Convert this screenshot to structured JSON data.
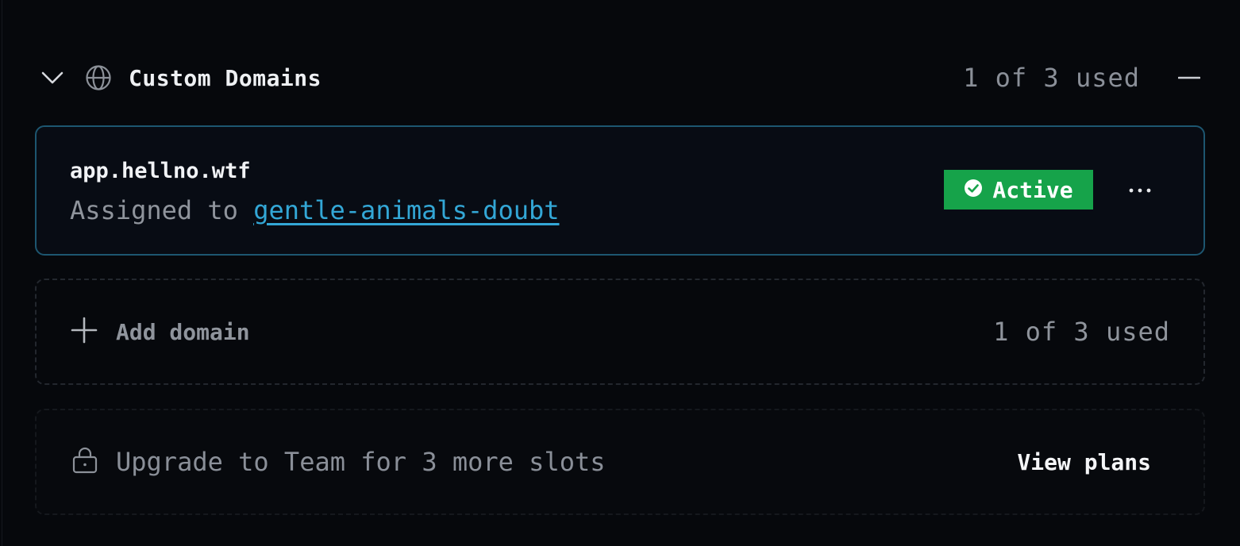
{
  "section": {
    "title": "Custom Domains",
    "usage": "1 of 3 used",
    "icons": {
      "toggle": "chevron-down-icon",
      "section": "globe-icon",
      "collapse": "minus-icon"
    }
  },
  "domains": [
    {
      "name": "app.hellno.wtf",
      "assigned_prefix": "Assigned to",
      "assigned_target": "gentle-animals-doubt",
      "status": "Active",
      "status_icon": "check-circle-icon",
      "menu_icon": "more-horizontal-icon"
    }
  ],
  "add_domain": {
    "label": "Add domain",
    "usage": "1 of 3 used",
    "icon": "plus-icon"
  },
  "upgrade": {
    "text": "Upgrade to Team for 3 more slots",
    "action": "View plans",
    "icon": "lock-icon"
  },
  "colors": {
    "background": "#06080c",
    "card_border": "#1d5670",
    "link": "#33a7d6",
    "status_active": "#16a34a",
    "muted_text": "#8f949c",
    "primary_text": "#f1f3f6"
  }
}
